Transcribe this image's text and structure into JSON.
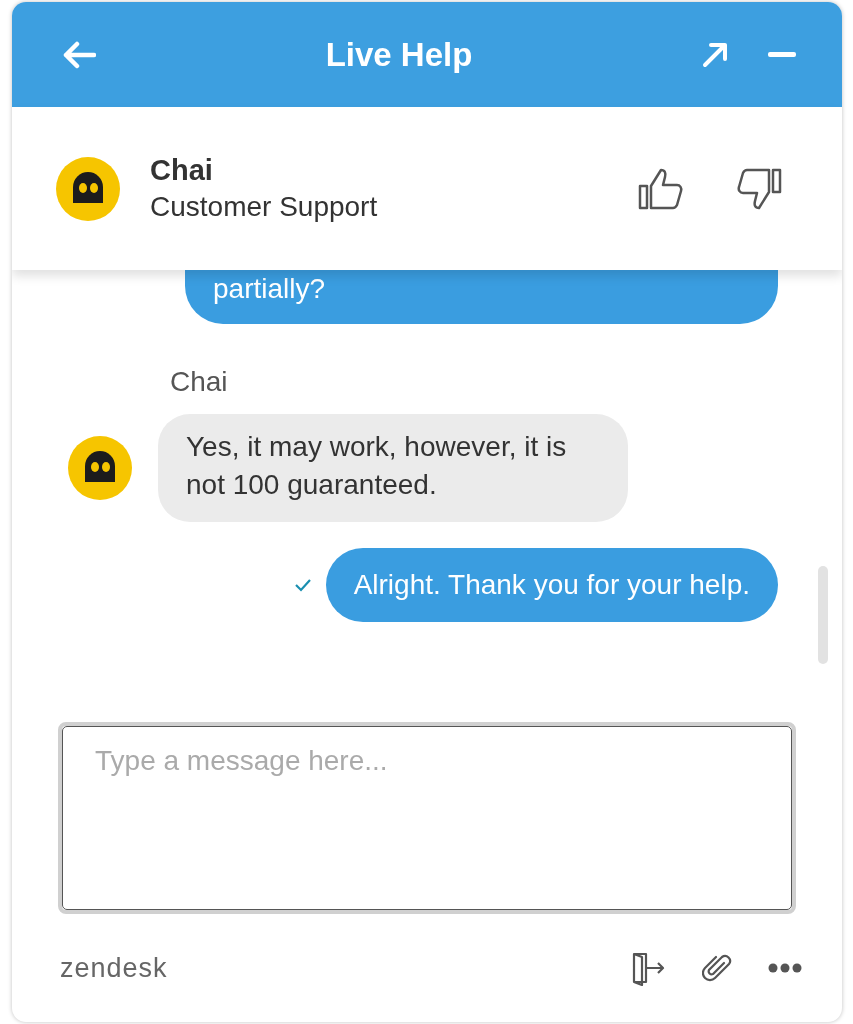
{
  "header": {
    "title": "Live Help"
  },
  "agent": {
    "name": "Chai",
    "role": "Customer Support"
  },
  "messages": [
    {
      "kind": "visitor",
      "text": "partially?",
      "delivered": false,
      "cut_top": true
    },
    {
      "kind": "agent_name",
      "text": "Chai"
    },
    {
      "kind": "agent",
      "text": "Yes, it may work, however, it is not 100 guaranteed."
    },
    {
      "kind": "visitor",
      "text": "Alright. Thank you for your help.",
      "delivered": true,
      "cut_top": false
    }
  ],
  "composer": {
    "placeholder": "Type a message here..."
  },
  "footer": {
    "brand": "zendesk"
  }
}
